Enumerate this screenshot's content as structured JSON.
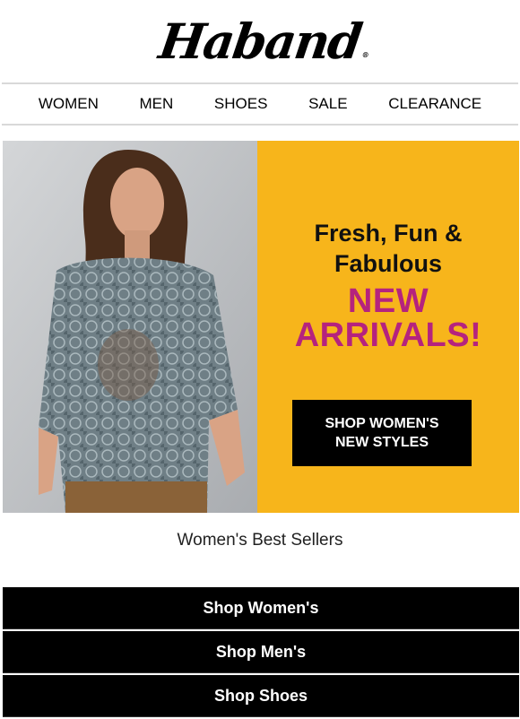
{
  "brand": {
    "logo_text": "Haband",
    "registered": "®"
  },
  "nav": {
    "items": [
      "WOMEN",
      "MEN",
      "SHOES",
      "SALE",
      "CLEARANCE"
    ]
  },
  "hero": {
    "tagline_1": "Fresh, Fun &",
    "tagline_2": "Fabulous",
    "headline_1": "NEW",
    "headline_2": "ARRIVALS!",
    "cta_line_1": "SHOP WOMEN'S",
    "cta_line_2": "NEW STYLES",
    "panel_color": "#f7b51b",
    "headline_color": "#b5237e"
  },
  "section": {
    "title": "Women's Best Sellers"
  },
  "shop_buttons": [
    "Shop Women's",
    "Shop Men's",
    "Shop Shoes"
  ]
}
